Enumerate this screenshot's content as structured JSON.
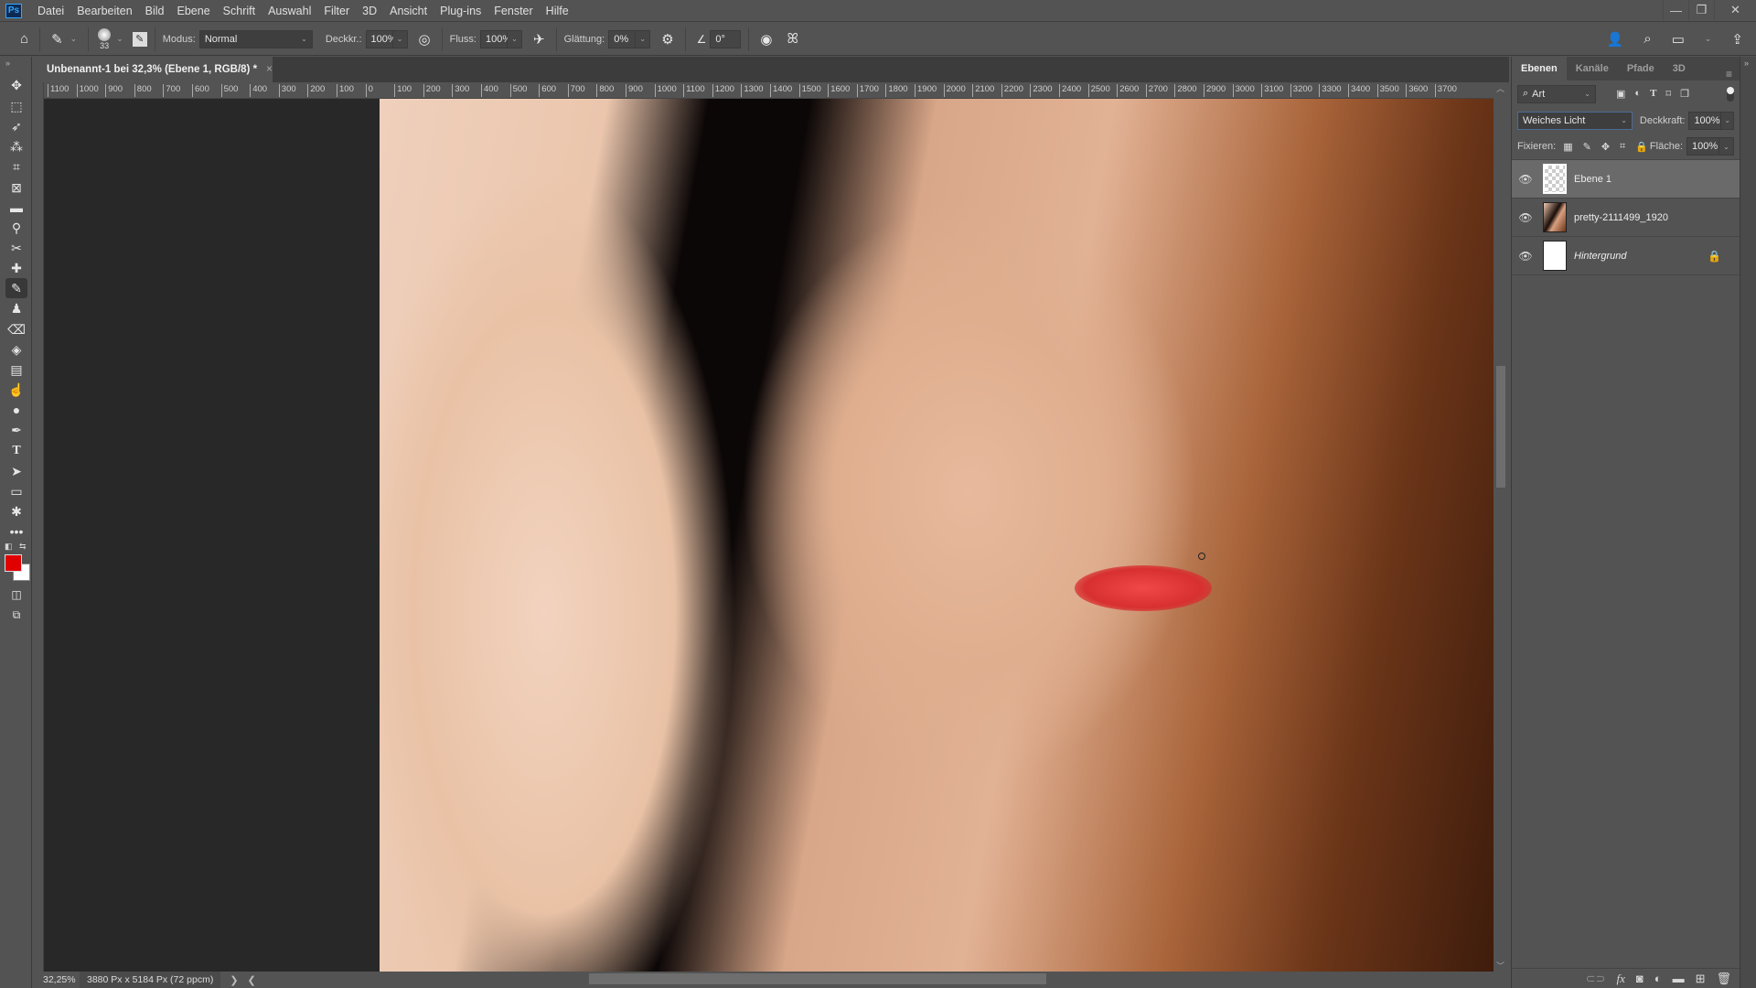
{
  "app": {
    "logo": "Ps"
  },
  "menu": [
    "Datei",
    "Bearbeiten",
    "Bild",
    "Ebene",
    "Schrift",
    "Auswahl",
    "Filter",
    "3D",
    "Ansicht",
    "Plug-ins",
    "Fenster",
    "Hilfe"
  ],
  "window_controls": {
    "minimize": "—",
    "restore": "❐",
    "close": "✕"
  },
  "options": {
    "brush_size": "33",
    "mode_label": "Modus:",
    "mode_value": "Normal",
    "opacity_label": "Deckkr.:",
    "opacity_value": "100%",
    "flow_label": "Fluss:",
    "flow_value": "100%",
    "smoothing_label": "Glättung:",
    "smoothing_value": "0%",
    "angle_value": "0°"
  },
  "document": {
    "tab_title": "Unbenannt-1 bei 32,3% (Ebene 1, RGB/8) *",
    "close": "×"
  },
  "ruler": {
    "top_ticks": [
      "1100",
      "1000",
      "900",
      "800",
      "700",
      "600",
      "500",
      "400",
      "300",
      "200",
      "100",
      "0",
      "100",
      "200",
      "300",
      "400",
      "500",
      "600",
      "700",
      "800",
      "900",
      "1000",
      "1100",
      "1200",
      "1300",
      "1400",
      "1500",
      "1600",
      "1700",
      "1800",
      "1900",
      "2000",
      "2100",
      "2200",
      "2300",
      "2400",
      "2500",
      "2600",
      "2700",
      "2800",
      "2900",
      "3000",
      "3100",
      "3200",
      "3300",
      "3400",
      "3500",
      "3600",
      "3700"
    ]
  },
  "status": {
    "zoom": "32,25%",
    "doc_info": "3880 Px x 5184 Px (72 ppcm)",
    "next": "❯",
    "prev": "❮"
  },
  "colors": {
    "foreground": "#e00000",
    "background": "#ffffff",
    "accent": "#31a8ff"
  },
  "tools": [
    "move-tool",
    "marquee-tool",
    "lasso-tool",
    "quick-selection-tool",
    "crop-tool",
    "frame-tool",
    "ruler-tool",
    "eyedropper-tool",
    "content-aware-move-tool",
    "healing-brush-tool",
    "brush-tool",
    "clone-stamp-tool",
    "eraser-tool",
    "paint-bucket-tool",
    "gradient-tool",
    "smudge-tool",
    "dodge-tool",
    "pen-tool",
    "type-tool",
    "path-selection-tool",
    "rectangle-tool",
    "custom-shape-tool",
    "more-tools"
  ],
  "layers_panel": {
    "tabs": [
      "Ebenen",
      "Kanäle",
      "Pfade",
      "3D"
    ],
    "active_tab": "Ebenen",
    "filter_label": "Art",
    "blend_mode": "Weiches Licht",
    "opacity_label": "Deckkraft:",
    "opacity_value": "100%",
    "lock_label": "Fixieren:",
    "fill_label": "Fläche:",
    "fill_value": "100%",
    "layers": [
      {
        "name": "Ebene 1",
        "visible": true,
        "selected": true,
        "locked": false
      },
      {
        "name": "pretty-2111499_1920",
        "visible": true,
        "selected": false,
        "locked": false
      },
      {
        "name": "Hintergrund",
        "visible": true,
        "selected": false,
        "locked": true
      }
    ]
  }
}
